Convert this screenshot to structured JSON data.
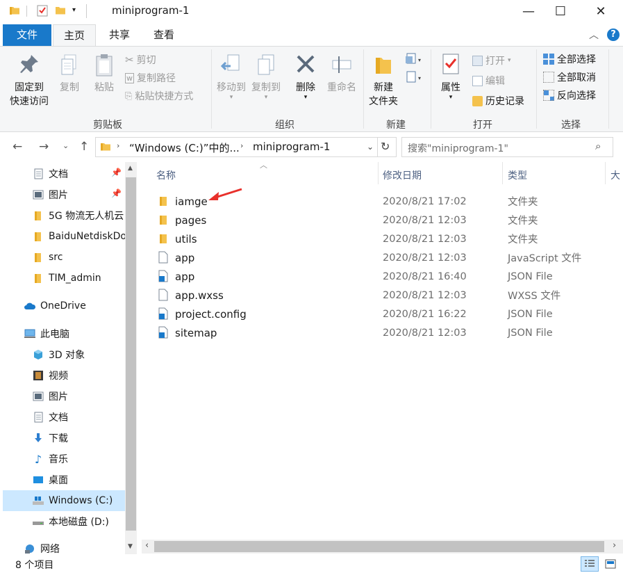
{
  "window": {
    "title": "miniprogram-1",
    "minimize": "—",
    "maximize": "☐",
    "close": "✕"
  },
  "tabs": [
    "文件",
    "主页",
    "共享",
    "查看"
  ],
  "ribbon": {
    "clipboard": {
      "label": "剪贴板",
      "pin_l1": "固定到",
      "pin_l2": "快速访问",
      "copy": "复制",
      "paste": "粘贴",
      "cut": "剪切",
      "copy_path": "复制路径",
      "paste_shortcut": "粘贴快捷方式"
    },
    "organize": {
      "label": "组织",
      "move_to": "移动到",
      "copy_to": "复制到",
      "delete": "删除",
      "rename": "重命名"
    },
    "new": {
      "label": "新建",
      "new_folder_l1": "新建",
      "new_folder_l2": "文件夹"
    },
    "open": {
      "label": "打开",
      "properties": "属性",
      "open": "打开",
      "edit": "编辑",
      "history": "历史记录"
    },
    "select": {
      "label": "选择",
      "select_all": "全部选择",
      "select_none": "全部取消",
      "invert": "反向选择"
    }
  },
  "address": {
    "crumb1": "“Windows (C:)”中的...",
    "crumb2": "miniprogram-1",
    "search_placeholder": "搜索\"miniprogram-1\""
  },
  "sidebar": {
    "quick": [
      "文档",
      "图片",
      "5G 物流无人机云",
      "BaiduNetdiskDo",
      "src",
      "TIM_admin"
    ],
    "onedrive": "OneDrive",
    "thispc": "此电脑",
    "pc_items": [
      "3D 对象",
      "视频",
      "图片",
      "文档",
      "下载",
      "音乐",
      "桌面",
      "Windows (C:)",
      "本地磁盘 (D:)"
    ],
    "network": "网络"
  },
  "columns": {
    "name": "名称",
    "date": "修改日期",
    "type": "类型",
    "size": "大"
  },
  "files": [
    {
      "name": "iamge",
      "date": "2020/8/21 17:02",
      "type": "文件夹",
      "icon": "folder-icon"
    },
    {
      "name": "pages",
      "date": "2020/8/21 12:03",
      "type": "文件夹",
      "icon": "folder-icon"
    },
    {
      "name": "utils",
      "date": "2020/8/21 12:03",
      "type": "文件夹",
      "icon": "folder-icon"
    },
    {
      "name": "app",
      "date": "2020/8/21 12:03",
      "type": "JavaScript 文件",
      "icon": "file-icon"
    },
    {
      "name": "app",
      "date": "2020/8/21 16:40",
      "type": "JSON File",
      "icon": "json-file-icon"
    },
    {
      "name": "app.wxss",
      "date": "2020/8/21 12:03",
      "type": "WXSS 文件",
      "icon": "file-icon"
    },
    {
      "name": "project.config",
      "date": "2020/8/21 16:22",
      "type": "JSON File",
      "icon": "json-file-icon"
    },
    {
      "name": "sitemap",
      "date": "2020/8/21 12:03",
      "type": "JSON File",
      "icon": "json-file-icon"
    }
  ],
  "status": {
    "count": "8 个项目"
  },
  "colors": {
    "accent": "#1979ca",
    "folder": "#f4c24d",
    "arrow": "#e8302b"
  }
}
